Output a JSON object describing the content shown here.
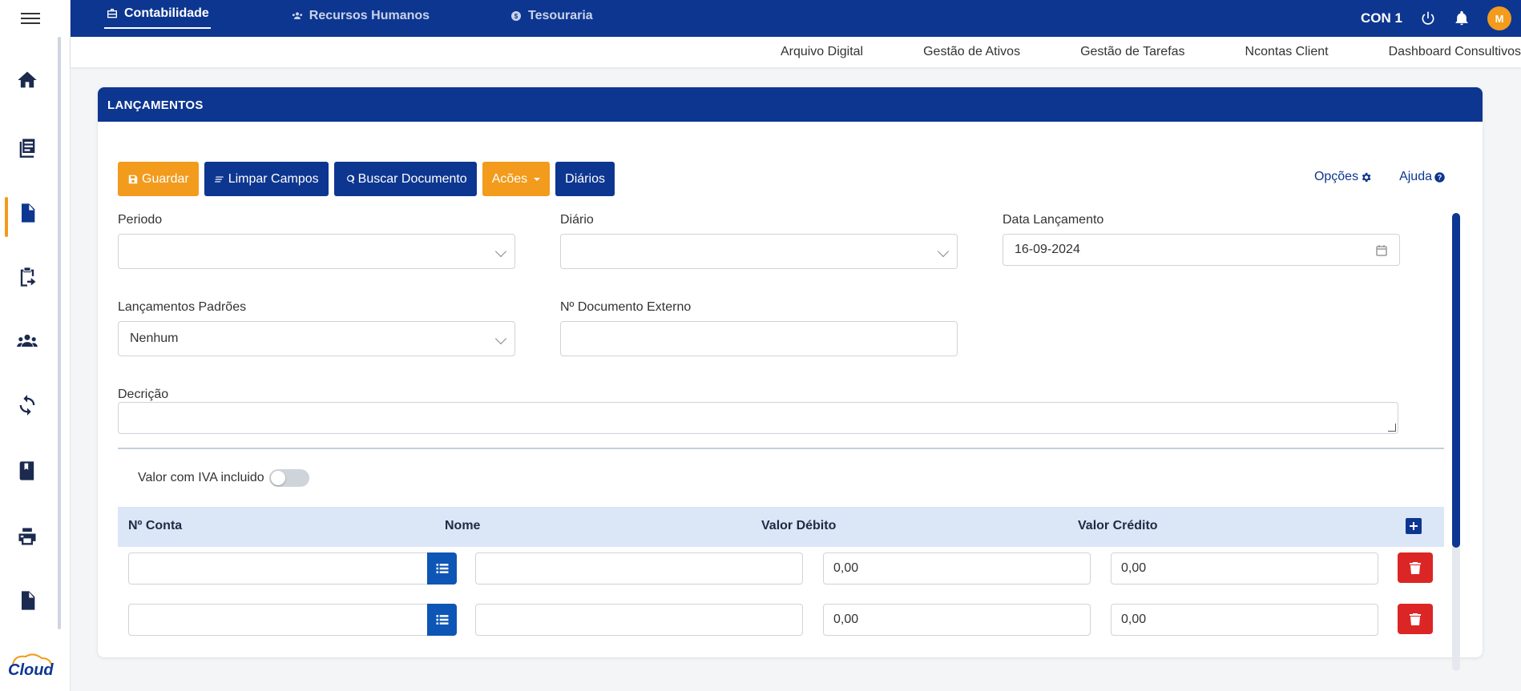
{
  "topbar": {
    "nav": [
      {
        "label": "Contabilidade",
        "icon": "briefcase-icon",
        "active": true
      },
      {
        "label": "Recursos Humanos",
        "icon": "users-icon",
        "active": false
      },
      {
        "label": "Tesouraria",
        "icon": "coin-icon",
        "active": false
      }
    ],
    "user_code": "CON 1",
    "avatar_initial": "M"
  },
  "subnav": {
    "links": [
      "Arquivo Digital",
      "Gestão de Ativos",
      "Gestão de Tarefas",
      "Ncontas Client",
      "Dashboard Consultivos"
    ]
  },
  "sidebar": {
    "items": [
      {
        "icon": "home-icon"
      },
      {
        "icon": "journal-icon"
      },
      {
        "icon": "document-icon",
        "active": true
      },
      {
        "icon": "clipboard-export-icon"
      },
      {
        "icon": "team-icon"
      },
      {
        "icon": "sync-icon"
      },
      {
        "icon": "book-icon"
      },
      {
        "icon": "printer-icon"
      },
      {
        "icon": "file-text-icon"
      }
    ],
    "logo_text": "Cloud"
  },
  "card": {
    "title": "LANÇAMENTOS",
    "toolbar": {
      "guardar": "Guardar",
      "limpar": "Limpar Campos",
      "buscar": "Buscar Documento",
      "acoes": "Acões",
      "diarios": "Diários"
    },
    "links": {
      "opcoes": "Opções",
      "ajuda": "Ajuda"
    },
    "fields": {
      "periodo": {
        "label": "Periodo",
        "value": ""
      },
      "diario": {
        "label": "Diário",
        "value": ""
      },
      "data": {
        "label": "Data Lançamento",
        "value": "16-09-2024"
      },
      "padroes": {
        "label": "Lançamentos Padrões",
        "value": "Nenhum"
      },
      "doc_externo": {
        "label": "Nº Documento Externo",
        "value": ""
      },
      "descricao": {
        "label": "Decrição",
        "value": ""
      }
    },
    "iva_label": "Valor com IVA incluido",
    "iva_on": false,
    "table": {
      "headers": [
        "Nº Conta",
        "Nome",
        "Valor Débito",
        "Valor Crédito"
      ],
      "rows": [
        {
          "conta": "",
          "nome": "",
          "debito": "0,00",
          "credito": "0,00"
        },
        {
          "conta": "",
          "nome": "",
          "debito": "0,00",
          "credito": "0,00"
        }
      ]
    }
  },
  "colors": {
    "primary": "#0d3690",
    "accent": "#f29b1c",
    "danger": "#dc2626",
    "table_header_bg": "#dbe6f7"
  }
}
